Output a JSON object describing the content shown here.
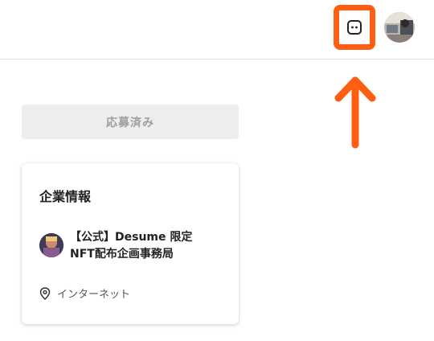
{
  "header": {
    "message_icon": "message-bubble-icon",
    "highlight_color": "#ff5e12",
    "avatar": "user-avatar"
  },
  "annotation": {
    "arrow_icon": "up-arrow-icon",
    "color": "#ff5e12"
  },
  "applied_button": {
    "label": "応募済み",
    "background": "#ededed",
    "text_color": "#9e9e9e"
  },
  "company_card": {
    "title": "企業情報",
    "company_name_line1": "【公式】Desume 限定",
    "company_name_line2": "NFT配布企画事務局",
    "location_icon": "map-pin-icon",
    "location": "インターネット"
  }
}
